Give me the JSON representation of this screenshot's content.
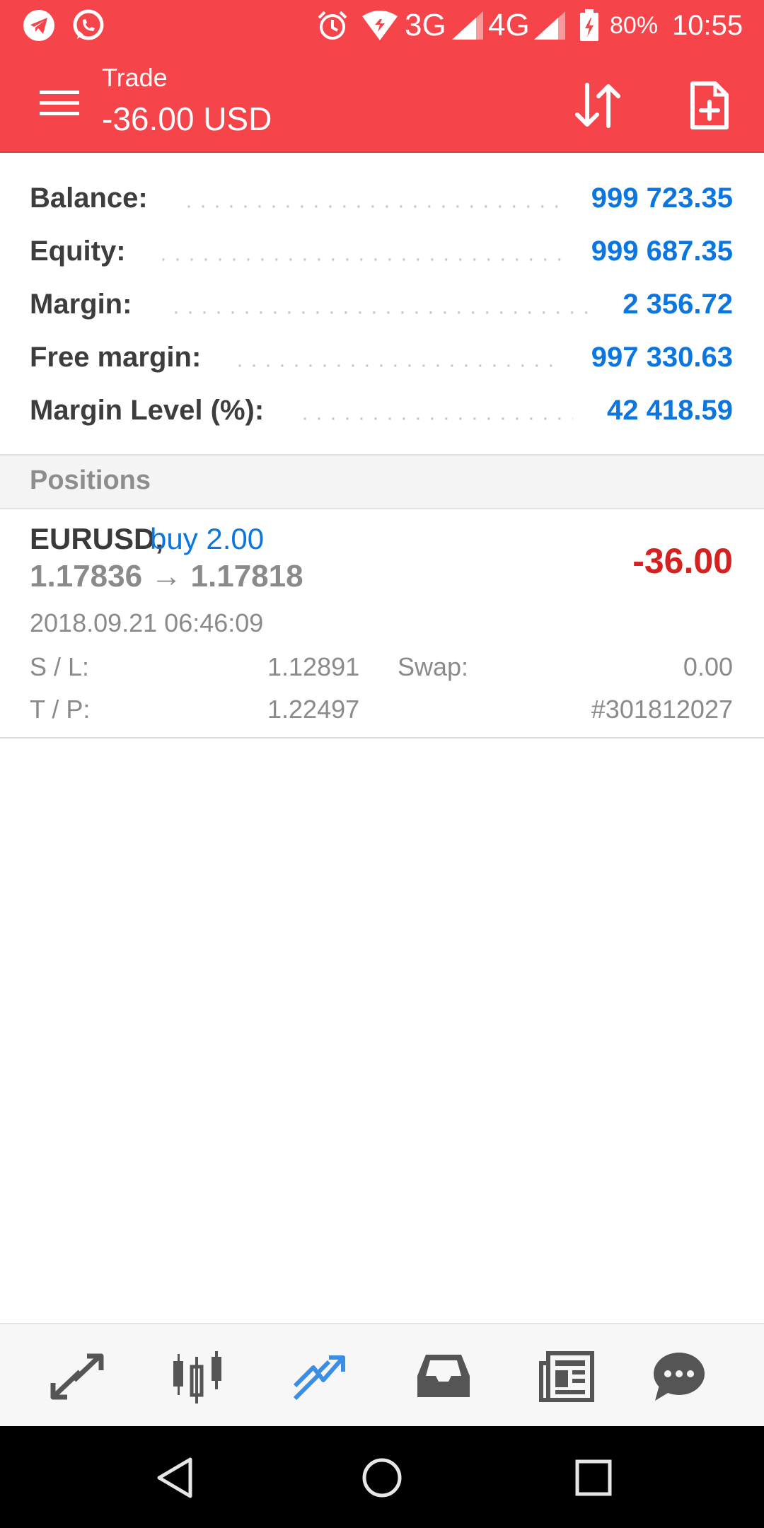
{
  "status_bar": {
    "icons": [
      "telegram-icon",
      "whatsapp-icon",
      "alarm-icon",
      "wifi-icon",
      "signal-3g-icon",
      "signal-4g-icon",
      "battery-icon"
    ],
    "net1": "3G",
    "net2": "4G",
    "battery": "80%",
    "time": "10:55"
  },
  "toolbar": {
    "subtitle": "Trade",
    "title": "-36.00 USD",
    "icons": [
      "menu-icon",
      "sort-icon",
      "new-order-icon"
    ]
  },
  "summary": {
    "balance_label": "Balance:",
    "balance": "999 723.35",
    "equity_label": "Equity:",
    "equity": "999 687.35",
    "margin_label": "Margin:",
    "margin": "2 356.72",
    "free_margin_label": "Free margin:",
    "free_margin": "997 330.63",
    "margin_level_label": "Margin Level (%):",
    "margin_level": "42 418.59"
  },
  "section": {
    "title": "Positions"
  },
  "position": {
    "symbol": "EURUSD,",
    "type": "buy 2.00",
    "open_price": "1.17836",
    "arrow": "→",
    "current_price": "1.17818",
    "profit": "-36.00",
    "time": "2018.09.21 06:46:09",
    "sl_label": "S / L:",
    "sl": "1.12891",
    "swap_label": "Swap:",
    "swap": "0.00",
    "tp_label": "T / P:",
    "tp": "1.22497",
    "ticket": "#301812027"
  },
  "bottom_nav": {
    "items": [
      "quotes-icon",
      "chart-icon",
      "trade-icon",
      "history-icon",
      "news-icon",
      "messages-icon"
    ],
    "active": "trade-icon"
  },
  "colors": {
    "header": "#f5454a",
    "accent_blue": "#0b76e0",
    "loss_red": "#d72020"
  }
}
